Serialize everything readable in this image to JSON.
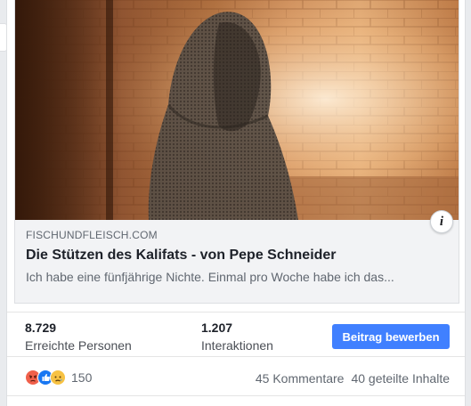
{
  "link_preview": {
    "domain": "FISCHUNDFLEISCH.COM",
    "headline": "Die Stützen des Kalifats - von Pepe Schneider",
    "description": "Ich habe eine fünfjährige Nichte. Einmal pro Woche habe ich das...",
    "info_icon": "i"
  },
  "stats": {
    "reach": {
      "value": "8.729",
      "label": "Erreichte Personen"
    },
    "engagement": {
      "value": "1.207",
      "label": "Interaktionen"
    },
    "promote_button": "Beitrag bewerben"
  },
  "engagement_bar": {
    "reaction_icons": [
      "angry-reaction-icon",
      "like-reaction-icon",
      "sad-reaction-icon"
    ],
    "reaction_count": "150",
    "comments": "45 Kommentare",
    "shares": "40 geteilte Inhalte"
  },
  "colors": {
    "accent": "#4080ff",
    "angry": "#f0604b",
    "like": "#1877f2",
    "sad": "#f7c243"
  }
}
